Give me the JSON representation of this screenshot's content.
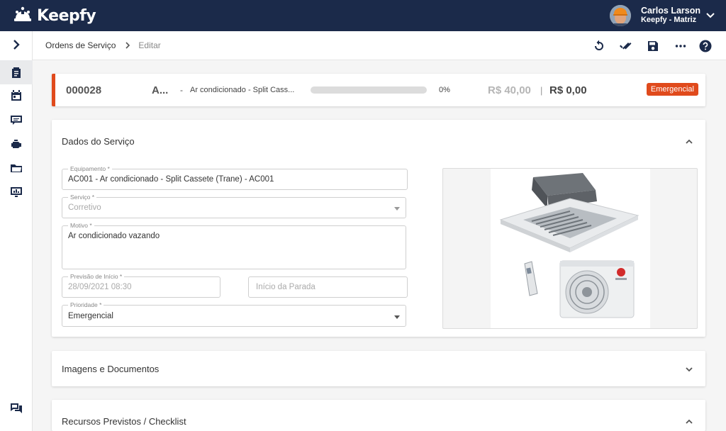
{
  "app": {
    "name": "Keepfy"
  },
  "user": {
    "name": "Carlos Larson",
    "org": "Keepfy - Matriz"
  },
  "breadcrumb": {
    "parent": "Ordens de Serviço",
    "current": "Editar"
  },
  "summary": {
    "code": "000028",
    "short": "A...",
    "dash": "-",
    "description": "Ar condicionado - Split Cass...",
    "progress": 0,
    "progress_label": "0%",
    "price_planned": "R$ 40,00",
    "separator": "|",
    "price_actual": "R$ 0,00",
    "priority_badge": "Emergencial"
  },
  "service_panel": {
    "title": "Dados do Serviço",
    "equipment": {
      "label": "Equipamento *",
      "value": "AC001 - Ar condicionado - Split Cassete (Trane) - AC001"
    },
    "service": {
      "label": "Serviço *",
      "value": "Corretivo"
    },
    "reason": {
      "label": "Motivo *",
      "value": "Ar condicionado vazando"
    },
    "start_forecast": {
      "label": "Previsão de Início *",
      "value": "28/09/2021 08:30"
    },
    "stop_start": {
      "placeholder": "Início da Parada"
    },
    "priority": {
      "label": "Prioridade *",
      "value": "Emergencial"
    }
  },
  "docs_panel": {
    "title": "Imagens e Documentos"
  },
  "resources_panel": {
    "title": "Recursos Previstos / Checklist"
  },
  "colors": {
    "topbar": "#1b2a4a",
    "accent": "#e04a1c"
  }
}
